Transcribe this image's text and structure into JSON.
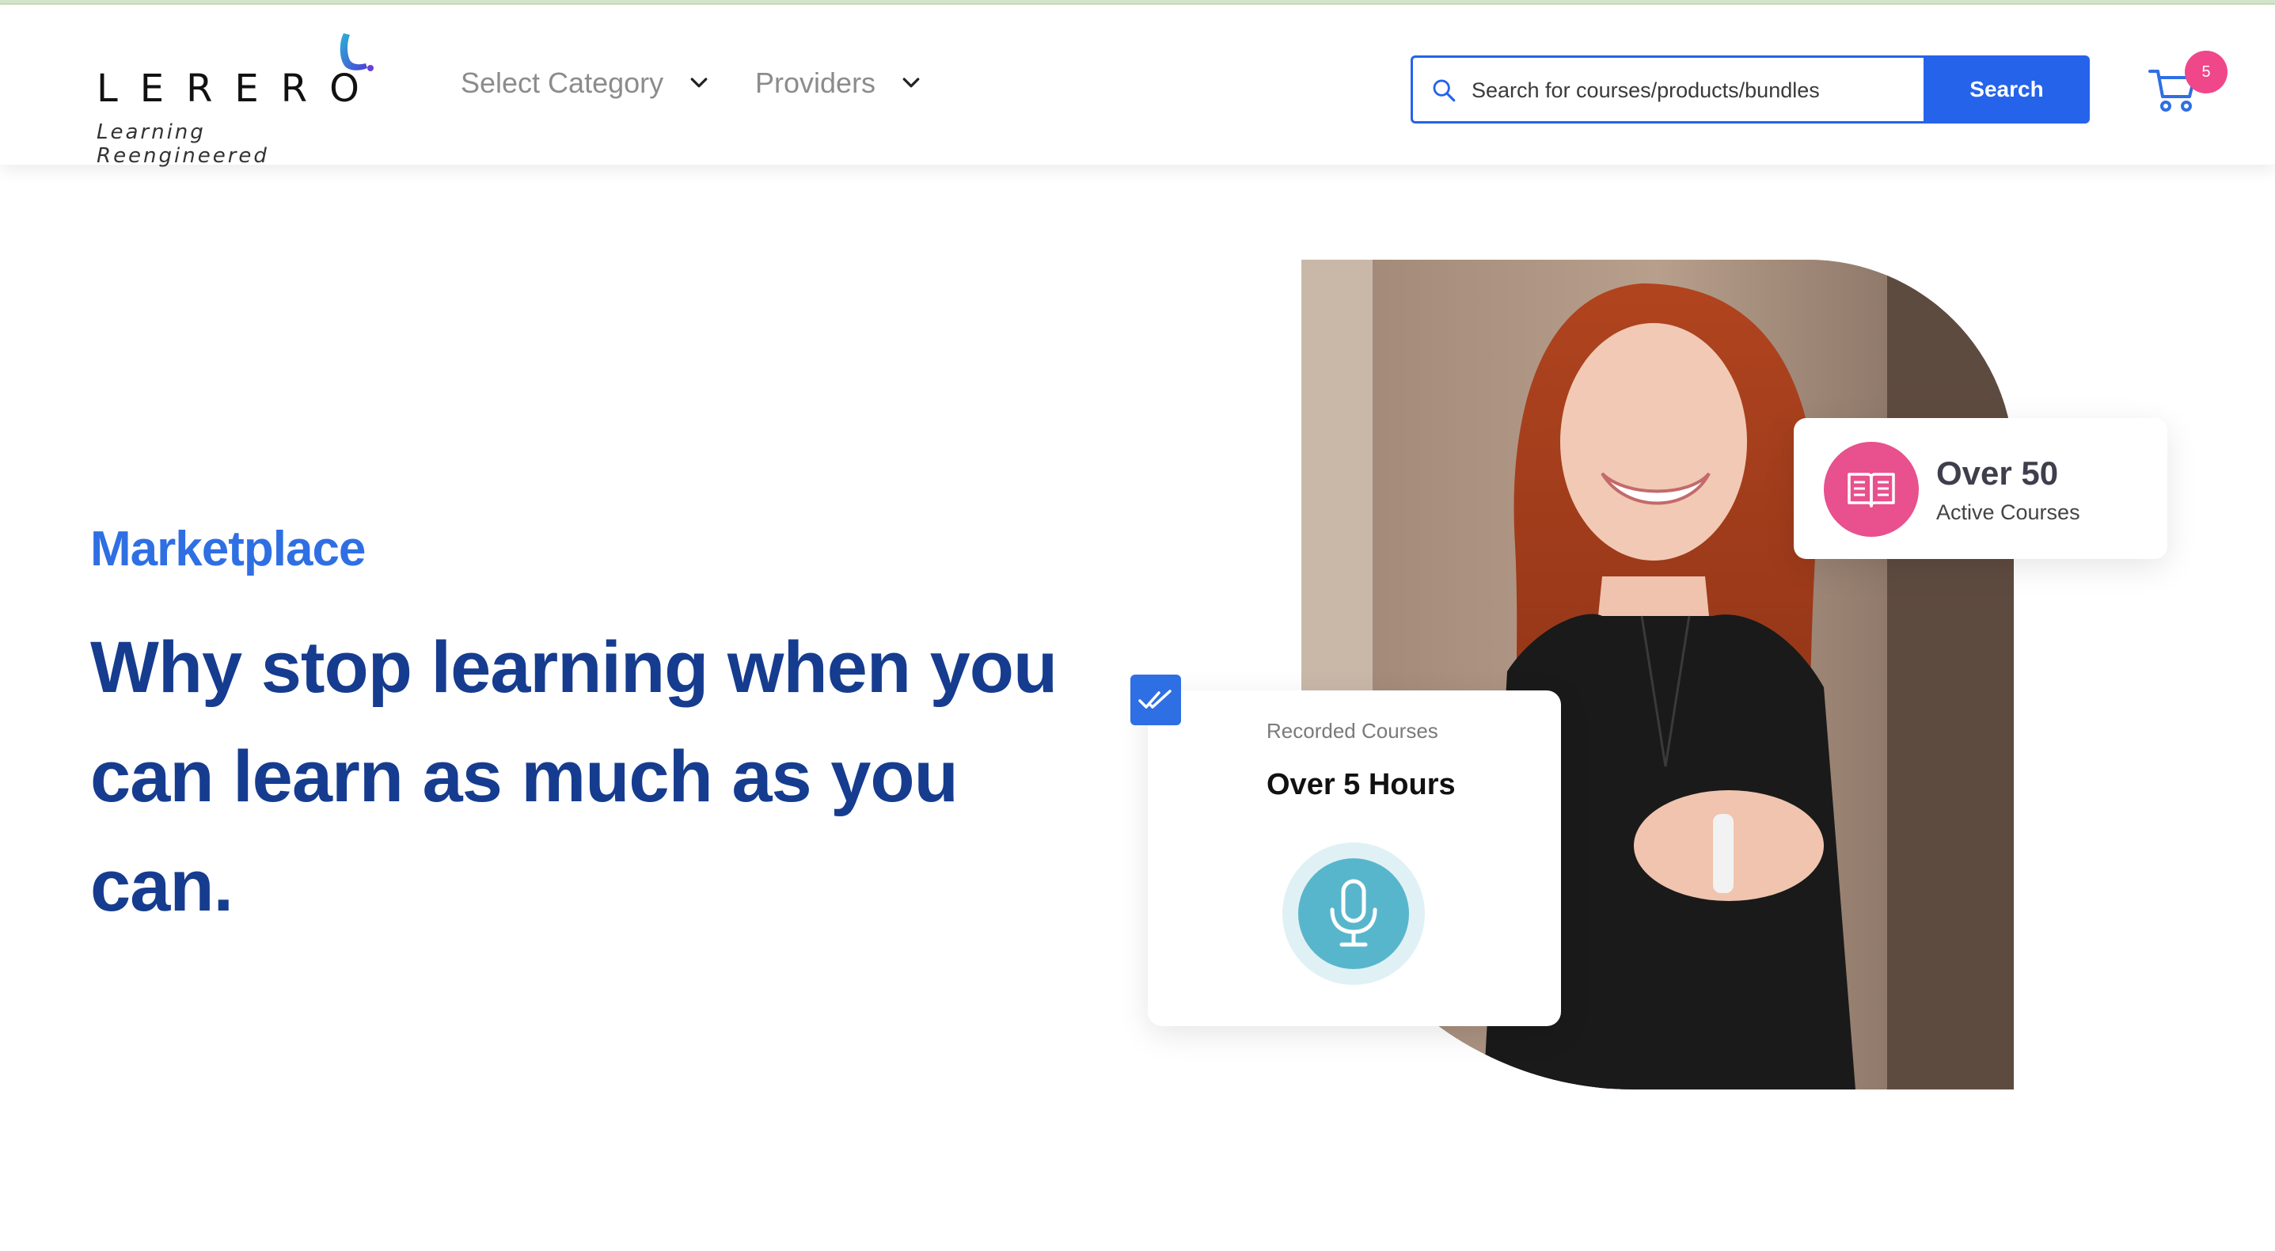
{
  "brand": {
    "name": "LERERO",
    "tagline": "Learning Reengineered",
    "colors": {
      "primary": "#2563eb",
      "heading": "#163c8f",
      "accent_pink": "#e8508e",
      "mic_teal": "#58b6cc"
    }
  },
  "nav": {
    "category_label": "Select Category",
    "providers_label": "Providers"
  },
  "search": {
    "placeholder": "Search for courses/products/bundles",
    "button_label": "Search"
  },
  "cart": {
    "count": "5"
  },
  "hero": {
    "eyebrow": "Marketplace",
    "headline": "Why stop learning when you can learn as much as you can.",
    "stat_card": {
      "title": "Over 50",
      "subtitle": "Active Courses",
      "icon": "open-book-icon"
    },
    "recorded_card": {
      "label": "Recorded Courses",
      "title": "Over 5 Hours",
      "icon": "microphone-icon",
      "badge_icon": "double-check-icon"
    }
  }
}
